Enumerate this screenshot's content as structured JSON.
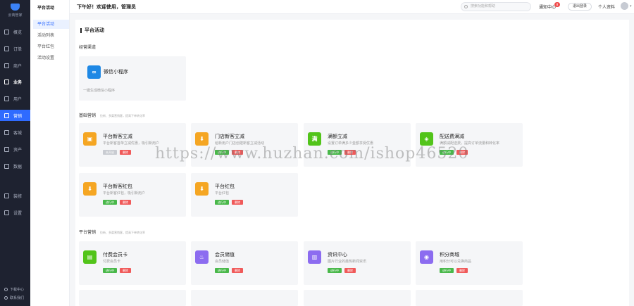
{
  "brand": {
    "logo_text": "云商管家"
  },
  "sidebar": {
    "items": [
      {
        "label": "概览"
      },
      {
        "label": "订单"
      },
      {
        "label": "商户"
      },
      {
        "label": "业务"
      },
      {
        "label": "用户"
      },
      {
        "label": "营销"
      },
      {
        "label": "客城"
      },
      {
        "label": "资产"
      },
      {
        "label": "数据"
      },
      {
        "label": "装修"
      },
      {
        "label": "设置"
      }
    ],
    "footer": [
      {
        "label": "下载中心"
      },
      {
        "label": "联系我们"
      }
    ]
  },
  "submenu": {
    "title": "平台活动",
    "items": [
      {
        "label": "平台活动"
      },
      {
        "label": "活动列表"
      },
      {
        "label": "平台红包"
      },
      {
        "label": "活动设置"
      }
    ]
  },
  "topbar": {
    "greeting": "下午好！欢迎使用，管理员",
    "search_placeholder": "搜索功能和帮助",
    "notice_label": "通知中心",
    "notice_count": "8",
    "logout_label": "退出登录",
    "profile_label": "个人资料"
  },
  "page": {
    "title": "平台活动"
  },
  "sections": {
    "channel": {
      "title": "经营渠道"
    },
    "basic": {
      "title": "基础营销",
      "hint": "拉新、多渠营销客，提高下单转化率"
    },
    "platform": {
      "title": "平台营销",
      "hint": "拉新、多渠营销客，提高下单转化率"
    }
  },
  "cards": {
    "wechat": {
      "name": "微信小程序",
      "desc": "一键生成微信小程序",
      "icon": "mini-program-icon",
      "color": "#1e88e5"
    },
    "newuser_minus": {
      "name": "平台新客立减",
      "desc": "平台新客首单立减优惠，吸引新用户",
      "tag1": "未开启",
      "tag2": "删除",
      "icon": "gift-icon",
      "color": "#f5a623"
    },
    "store_minus": {
      "name": "门店新客立减",
      "desc": "给新用户门店创建新客立减活动",
      "tag1": "进行中",
      "tag2": "删除",
      "icon": "arrow-down-circle-icon",
      "color": "#f5a623"
    },
    "full_minus": {
      "name": "满额立减",
      "desc": "设置订单满多少金额享受优惠",
      "tag1": "进行中",
      "tag2": "删除",
      "icon": "full-minus-icon",
      "color": "#52c41a",
      "glyph": "满"
    },
    "delivery_minus": {
      "name": "配送费满减",
      "desc": "满额减配送费，提高订单流量和转化率",
      "tag1": "进行中",
      "tag2": "删除",
      "icon": "tag-icon",
      "color": "#52c41a"
    },
    "newuser_redpack": {
      "name": "平台新客红包",
      "desc": "平台新客红包，吸引新用户",
      "tag1": "进行中",
      "tag2": "删除",
      "icon": "redpack-icon",
      "color": "#f5a623"
    },
    "platform_redpack": {
      "name": "平台红包",
      "desc": "平台红包",
      "tag1": "进行中",
      "tag2": "删除",
      "icon": "redpack-icon",
      "color": "#f5a623"
    },
    "member_card": {
      "name": "付费会员卡",
      "desc": "付费会员卡",
      "tag1": "进行中",
      "tag2": "删除",
      "icon": "member-card-icon",
      "color": "#52c41a"
    },
    "member_recharge": {
      "name": "会员储值",
      "desc": "会员储值",
      "tag1": "进行中",
      "tag2": "删除",
      "icon": "cake-icon",
      "color": "#8c6cf0"
    },
    "news": {
      "name": "资讯中心",
      "desc": "图片行业的最热新闻资讯",
      "tag1": "进行中",
      "tag2": "删除",
      "icon": "news-icon",
      "color": "#8c6cf0"
    },
    "points_mall": {
      "name": "积分商城",
      "desc": "用积分可以兑换商品",
      "tag1": "进行中",
      "tag2": "删除",
      "icon": "points-icon",
      "color": "#8c6cf0"
    }
  },
  "watermark": "https://www.huzhan.com/ishop46520"
}
